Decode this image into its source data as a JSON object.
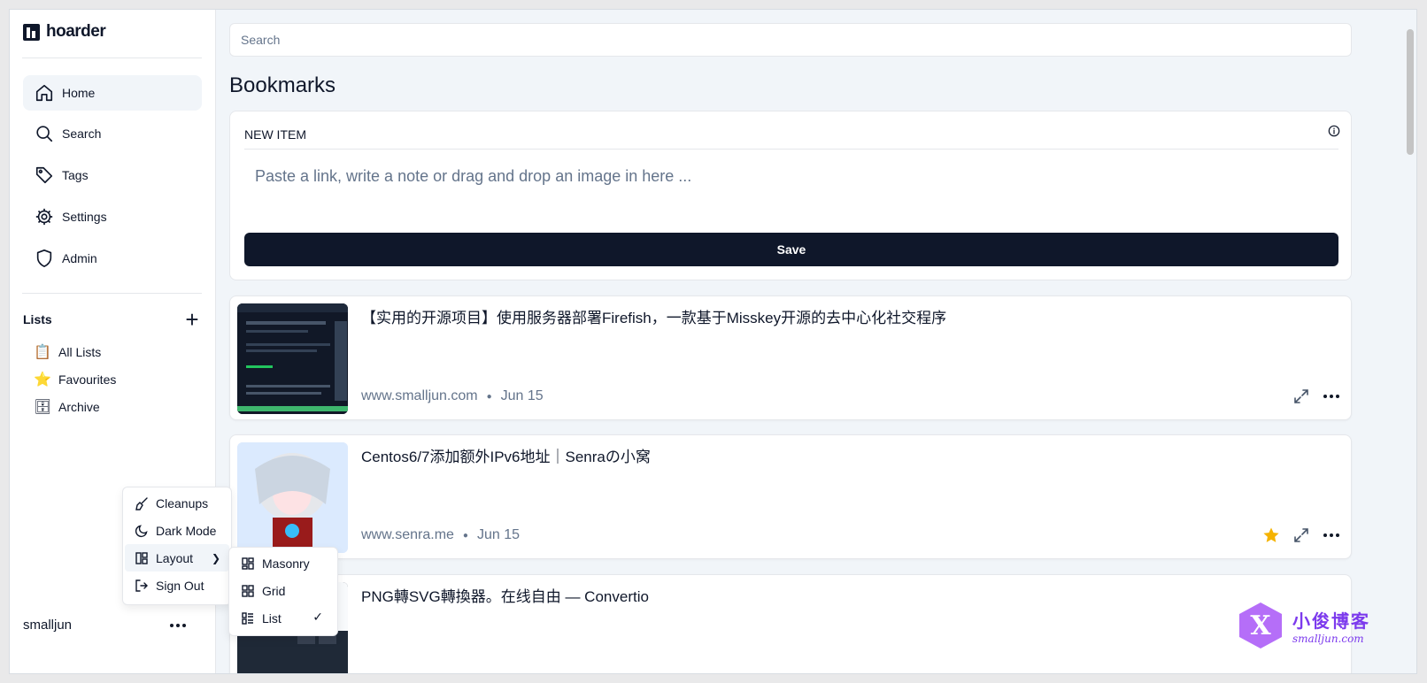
{
  "app": {
    "name": "hoarder"
  },
  "sidebar": {
    "nav": [
      {
        "label": "Home",
        "icon": "home-icon"
      },
      {
        "label": "Search",
        "icon": "search-icon"
      },
      {
        "label": "Tags",
        "icon": "tag-icon"
      },
      {
        "label": "Settings",
        "icon": "gear-icon"
      },
      {
        "label": "Admin",
        "icon": "shield-icon"
      }
    ],
    "lists_title": "Lists",
    "lists": [
      {
        "label": "All Lists",
        "emoji": "📋"
      },
      {
        "label": "Favourites",
        "emoji": "⭐"
      },
      {
        "label": "Archive",
        "emoji": "🗄"
      }
    ],
    "user": "smalljun"
  },
  "user_menu": {
    "items": [
      {
        "label": "Cleanups",
        "icon": "broom-icon"
      },
      {
        "label": "Dark Mode",
        "icon": "moon-icon"
      },
      {
        "label": "Layout",
        "icon": "layout-icon"
      },
      {
        "label": "Sign Out",
        "icon": "sign-out-icon"
      }
    ]
  },
  "layout_menu": {
    "items": [
      {
        "label": "Masonry",
        "icon": "masonry-icon"
      },
      {
        "label": "Grid",
        "icon": "grid-icon"
      },
      {
        "label": "List",
        "icon": "list-icon",
        "checked": true
      }
    ]
  },
  "main": {
    "search_placeholder": "Search",
    "title": "Bookmarks",
    "new_item": {
      "label": "NEW ITEM",
      "placeholder": "Paste a link, write a note or drag and drop an image in here ...",
      "save_label": "Save"
    },
    "bookmarks": [
      {
        "title": "【实用的开源项目】使用服务器部署Firefish，一款基于Misskey开源的去中心化社交程序",
        "domain": "www.smalljun.com",
        "date": "Jun 15",
        "favourited": false
      },
      {
        "title": "Centos6/7添加额外IPv6地址｜Senraの小窝",
        "domain": "www.senra.me",
        "date": "Jun 15",
        "favourited": true
      },
      {
        "title": "PNG轉SVG轉換器。在线自由 — Convertio",
        "domain": "",
        "date": "",
        "favourited": false
      }
    ]
  },
  "watermark": {
    "line1": "小俊博客",
    "line2": "smalljun.com"
  },
  "colors": {
    "primary": "#0f172a",
    "star": "#f5b301",
    "muted": "#64748b"
  }
}
